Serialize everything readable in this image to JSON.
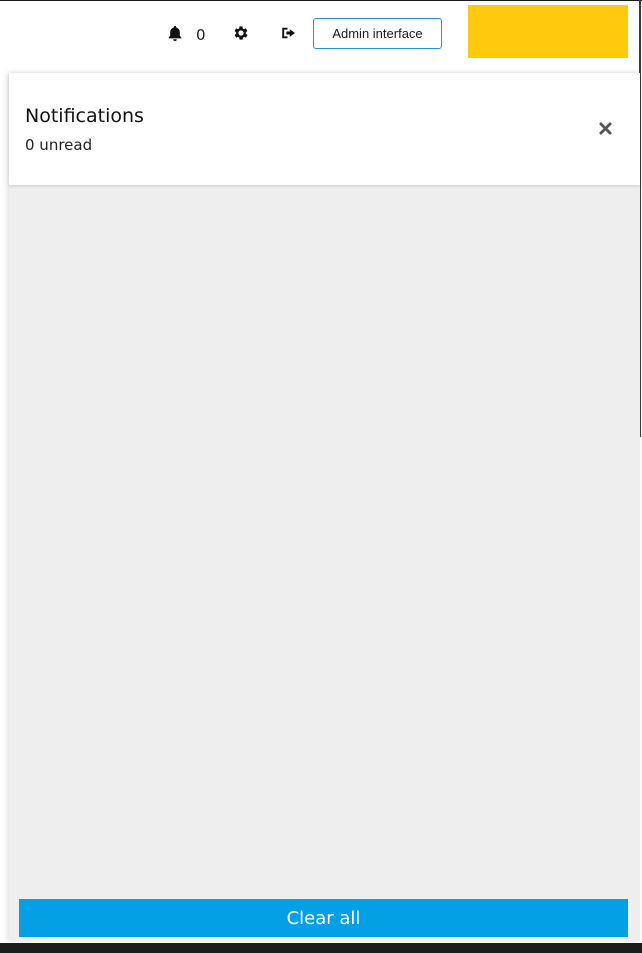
{
  "header": {
    "notification_count": "0",
    "admin_button_label": "Admin interface",
    "brand_color": "#ffc90e",
    "icons": {
      "bell": "bell-icon",
      "settings": "gear-icon",
      "logout": "logout-icon"
    }
  },
  "notifications_panel": {
    "title": "Notifications",
    "unread_summary": "0 unread",
    "close_icon": "close-icon",
    "clear_all_label": "Clear all",
    "accent_color": "#03a0e6",
    "items": []
  }
}
